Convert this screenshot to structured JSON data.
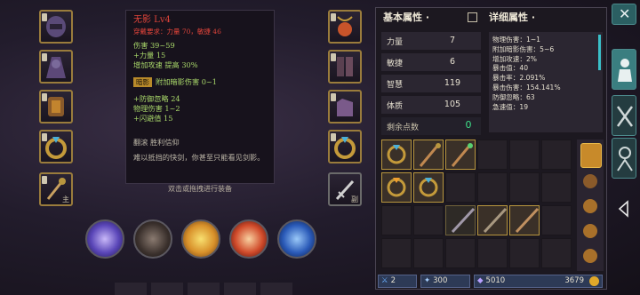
{
  "tooltip": {
    "name": "无影 Lv4",
    "requirement": "穿戴要求：力量 70，敏捷 46",
    "lines_a": [
      "伤害  39~59",
      "+力量 15",
      "增加攻速  提高 30%"
    ],
    "badge": "暗影",
    "badge_text": "附加暗影伤害 0~1",
    "lines_b": [
      "+防御忽略  24",
      "物理伤害  1~2",
      "+闪避值  15"
    ],
    "set_text": "翻滚  胜利信仰",
    "flavor": "难以抵挡的快剑，你甚至只能看见剑影。"
  },
  "hint": "双击或拖拽进行装备",
  "left_slots": {
    "bottom_tag": "主"
  },
  "right_slots": {
    "bottom_tag": "副"
  },
  "stats": {
    "basic_title": "基本属性 ·",
    "detail_title": "详细属性 ·",
    "rows": [
      {
        "label": "力量",
        "value": "7"
      },
      {
        "label": "敏捷",
        "value": "6"
      },
      {
        "label": "智慧",
        "value": "119"
      },
      {
        "label": "体质",
        "value": "105"
      }
    ],
    "points_label": "剩余点数",
    "points_value": "0",
    "details": [
      "物理伤害：1~1",
      "附加暗影伤害：5~6",
      "增加攻速：2%",
      "暴击值：40",
      "暴击率：2.091%",
      "暴击伤害：154.141%",
      "防御忽略：63",
      "急速值：19"
    ]
  },
  "currency": {
    "item_a": "2",
    "item_b": "300",
    "gems": "5010",
    "gold": "3679"
  },
  "colors": {
    "accent": "#b8963e",
    "teal": "#2b5f62"
  },
  "side_buttons": [
    "close-icon",
    "character-icon",
    "crossed-swords-icon",
    "skill-icon",
    "back-icon"
  ]
}
